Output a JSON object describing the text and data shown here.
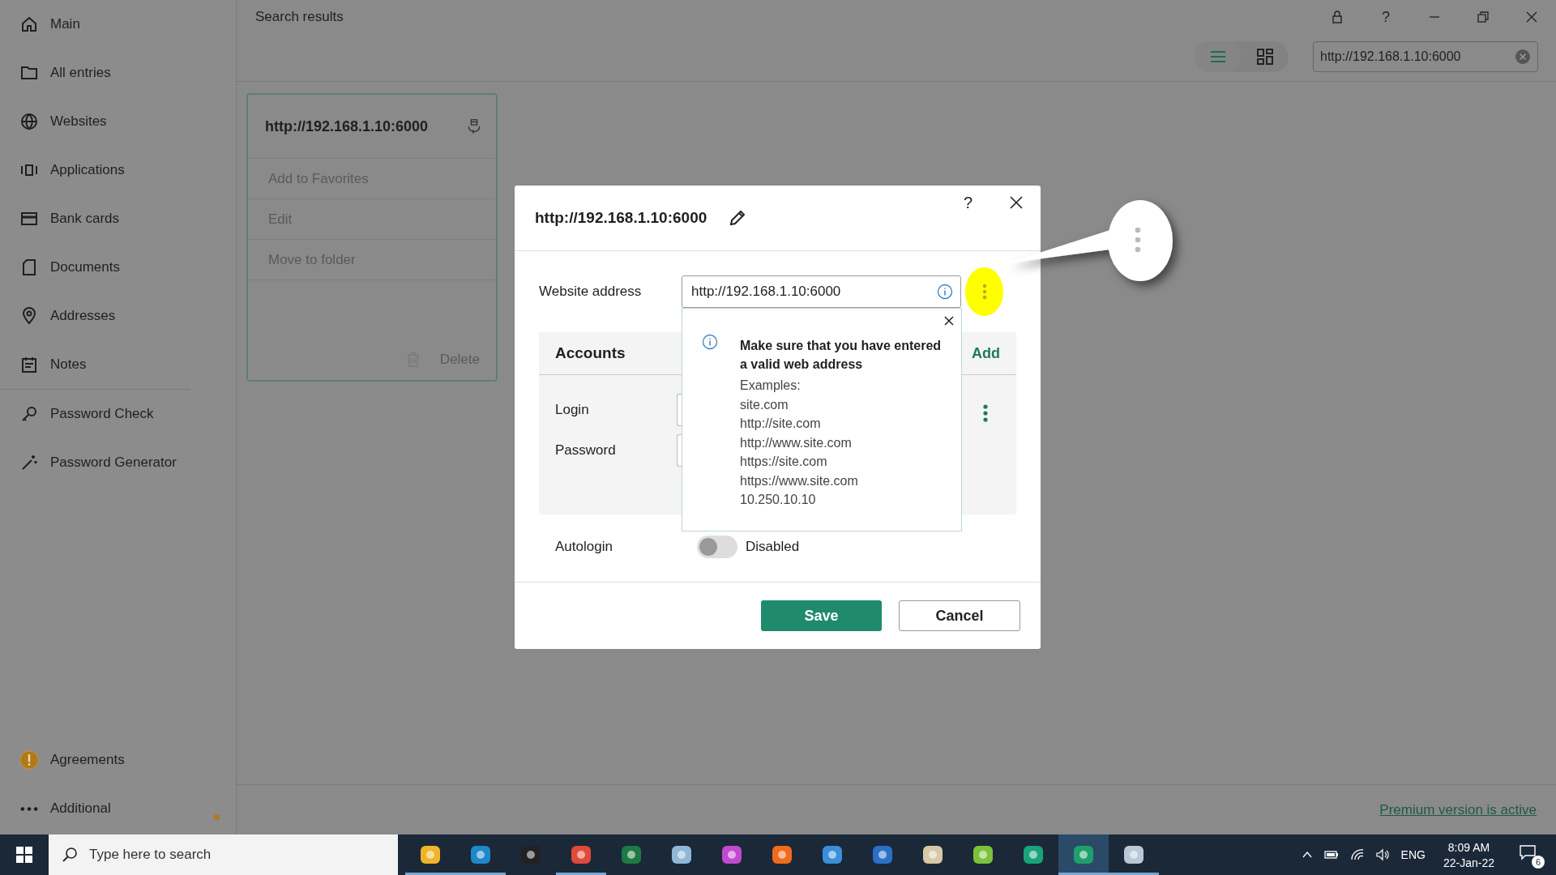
{
  "sidebar": {
    "items": [
      {
        "label": "Main",
        "kind": "home"
      },
      {
        "label": "All entries",
        "kind": "folder"
      },
      {
        "label": "Websites",
        "kind": "globe"
      },
      {
        "label": "Applications",
        "kind": "apps"
      },
      {
        "label": "Bank cards",
        "kind": "card"
      },
      {
        "label": "Documents",
        "kind": "doc"
      },
      {
        "label": "Addresses",
        "kind": "pin"
      },
      {
        "label": "Notes",
        "kind": "notes"
      },
      {
        "label": "Password Check",
        "kind": "key"
      },
      {
        "label": "Password Generator",
        "kind": "wand"
      }
    ],
    "bottom_items": [
      {
        "label": "Agreements",
        "kind": "warning"
      },
      {
        "label": "Additional",
        "kind": "more"
      }
    ]
  },
  "header": {
    "title": "Search results",
    "search": {
      "value": "http://192.168.1.10:6000"
    },
    "view_modes": [
      {
        "kind": "list",
        "selected": true
      },
      {
        "kind": "grid",
        "selected": false
      }
    ]
  },
  "card": {
    "title": "http://192.168.1.10:6000",
    "menu": [
      "Add to Favorites",
      "Edit",
      "Move to folder"
    ],
    "delete": "Delete"
  },
  "dialog": {
    "title": "http://192.168.1.10:6000",
    "help": "?",
    "website_label": "Website address",
    "website_value": "http://192.168.1.10:6000",
    "accounts": {
      "title": "Accounts",
      "add": "Add",
      "fields": [
        "Login",
        "Password"
      ]
    },
    "autologin": {
      "label": "Autologin",
      "on": false,
      "state_text": "Disabled"
    },
    "buttons": {
      "save": "Save",
      "cancel": "Cancel"
    }
  },
  "tooltip": {
    "heading": "Make sure that you have entered a valid web address",
    "lines": [
      "Examples:",
      "site.com",
      "http://site.com",
      "http://www.site.com",
      "https://site.com",
      "https://www.site.com",
      "10.250.10.10"
    ]
  },
  "status_bar": {
    "link": "Premium version is active"
  },
  "taskbar": {
    "search_placeholder": "Type here to search",
    "language": "ENG",
    "time": "8:09 AM",
    "date": "22-Jan-22",
    "notifications": "6"
  }
}
